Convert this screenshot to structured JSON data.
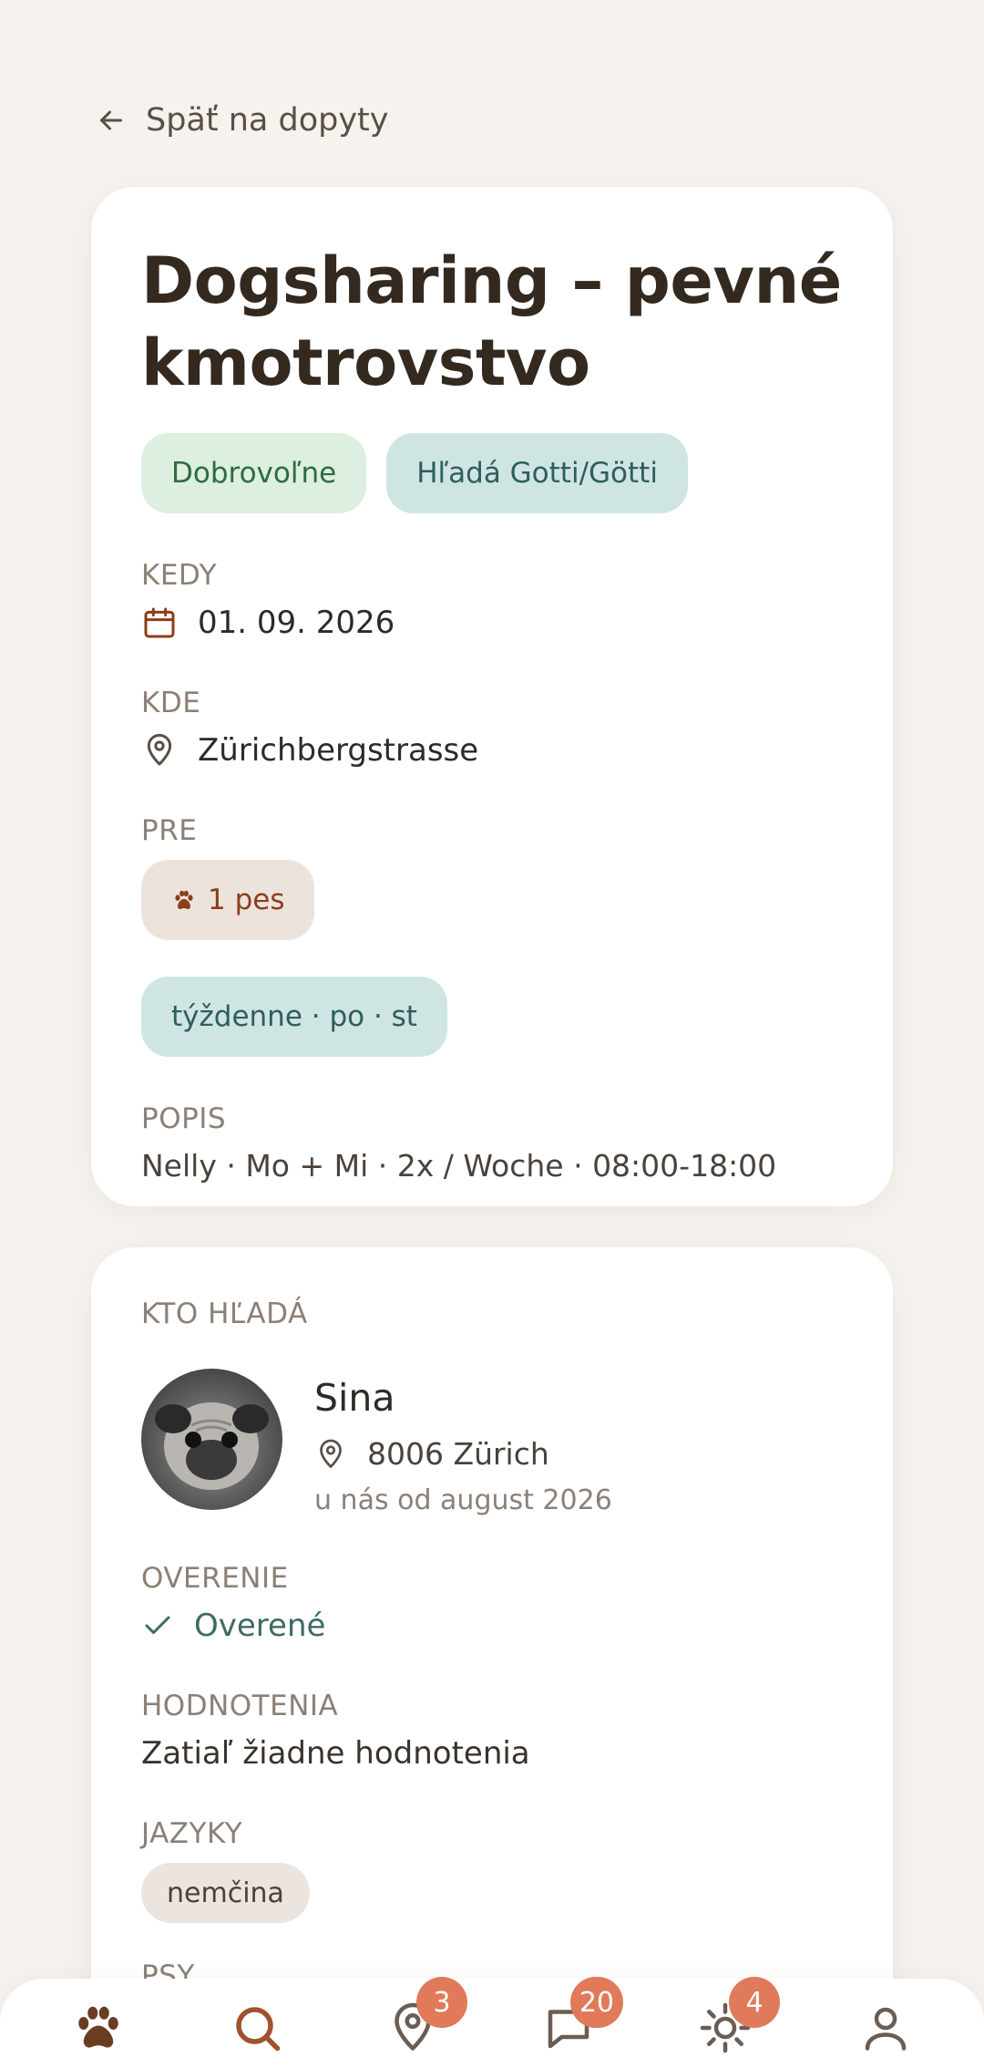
{
  "back": {
    "label": "Späť na dopyty"
  },
  "listing": {
    "title": "Dogsharing – pevné kmotrovstvo",
    "tags": [
      "Dobrovoľne",
      "Hľadá Gotti/Götti"
    ],
    "when_label": "KEDY",
    "when_value": "01. 09. 2026",
    "where_label": "KDE",
    "where_value": "Zürichbergstrasse",
    "for_label": "PRE",
    "for_value": "1 pes",
    "schedule": "týždenne · po · st",
    "desc_label": "POPIS",
    "desc_value": "Nelly · Mo + Mi · 2x / Woche · 08:00-18:00"
  },
  "owner": {
    "section_label": "KTO HĽADÁ",
    "name": "Sina",
    "location": "8006 Zürich",
    "since": "u nás od august 2026",
    "verification_label": "OVERENIE",
    "verification_value": "Overené",
    "ratings_label": "HODNOTENIA",
    "ratings_value": "Zatiaľ žiadne hodnotenia",
    "languages_label": "JAZYKY",
    "languages": [
      "nemčina"
    ],
    "dogs_label": "PSY"
  },
  "nav": {
    "items": [
      {
        "icon": "paw-icon"
      },
      {
        "icon": "search-icon"
      },
      {
        "icon": "map-pin-icon",
        "badge": "3"
      },
      {
        "icon": "chat-icon",
        "badge": "20"
      },
      {
        "icon": "sun-icon",
        "badge": "4"
      },
      {
        "icon": "profile-icon"
      }
    ]
  },
  "colors": {
    "background": "#f6f2ee",
    "card": "#ffffff",
    "accent_brown": "#8a3f1a",
    "badge": "#e07a5a",
    "green_chip": "#dcefe0",
    "teal_chip": "#cfe5e4"
  }
}
